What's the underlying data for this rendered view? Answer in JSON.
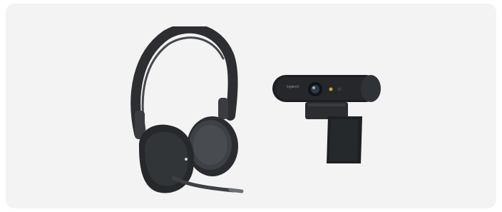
{
  "card": {
    "background": "#f2f3f2"
  },
  "products": [
    {
      "name": "headset",
      "icon": "headset-icon",
      "color": "#2b2d30"
    },
    {
      "name": "webcam",
      "icon": "webcam-icon",
      "color": "#1f2124",
      "logo_text": "logitech"
    }
  ]
}
